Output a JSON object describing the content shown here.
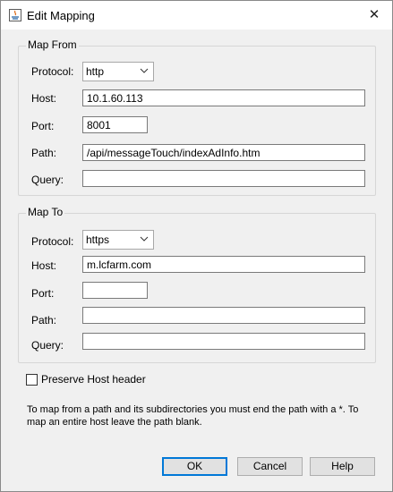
{
  "window": {
    "title": "Edit Mapping"
  },
  "map_from": {
    "legend": "Map From",
    "protocol_label": "Protocol:",
    "protocol_value": "http",
    "host_label": "Host:",
    "host_value": "10.1.60.113",
    "port_label": "Port:",
    "port_value": "8001",
    "path_label": "Path:",
    "path_value": "/api/messageTouch/indexAdInfo.htm",
    "query_label": "Query:",
    "query_value": ""
  },
  "map_to": {
    "legend": "Map To",
    "protocol_label": "Protocol:",
    "protocol_value": "https",
    "host_label": "Host:",
    "host_value": "m.lcfarm.com",
    "port_label": "Port:",
    "port_value": "",
    "path_label": "Path:",
    "path_value": "",
    "query_label": "Query:",
    "query_value": ""
  },
  "preserve_host": {
    "label": "Preserve Host header",
    "checked": false
  },
  "help_text": "To map from a path and its subdirectories you must end the path with a *. To map an entire host leave the path blank.",
  "buttons": {
    "ok": "OK",
    "cancel": "Cancel",
    "help": "Help"
  }
}
